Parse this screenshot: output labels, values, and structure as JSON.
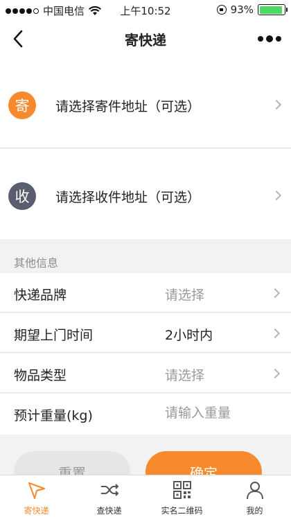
{
  "status_bar": {
    "carrier": "中国电信",
    "time": "上午10:52",
    "battery": "93%",
    "battery_level": 0.93,
    "signal_bars": 4
  },
  "nav": {
    "title": "寄快递"
  },
  "sender": {
    "badge": "寄",
    "label": "请选择寄件地址（可选）"
  },
  "receiver": {
    "badge": "收",
    "label": "请选择收件地址（可选）"
  },
  "other_info": {
    "header": "其他信息",
    "rows": [
      {
        "key": "快递品牌",
        "value": "请选择"
      },
      {
        "key": "期望上门时间",
        "value": "2小时内"
      },
      {
        "key": "物品类型",
        "value": "请选择"
      },
      {
        "key": "预计重量(kg)",
        "placeholder": "请输入重量"
      }
    ]
  },
  "actions": {
    "reset": "重置",
    "confirm": "确定"
  },
  "tab_bar": {
    "tabs": [
      {
        "label": "寄快递",
        "icon": "paper-plane-icon"
      },
      {
        "label": "查快递",
        "icon": "shuffle-icon"
      },
      {
        "label": "实名二维码",
        "icon": "qr-code-icon"
      },
      {
        "label": "我的",
        "icon": "person-icon"
      }
    ]
  },
  "colors": {
    "accent": "#f78a2c",
    "receiver_badge": "#5a5d6e",
    "placeholder": "#9a9a9a",
    "background": "#f2f2f2"
  }
}
